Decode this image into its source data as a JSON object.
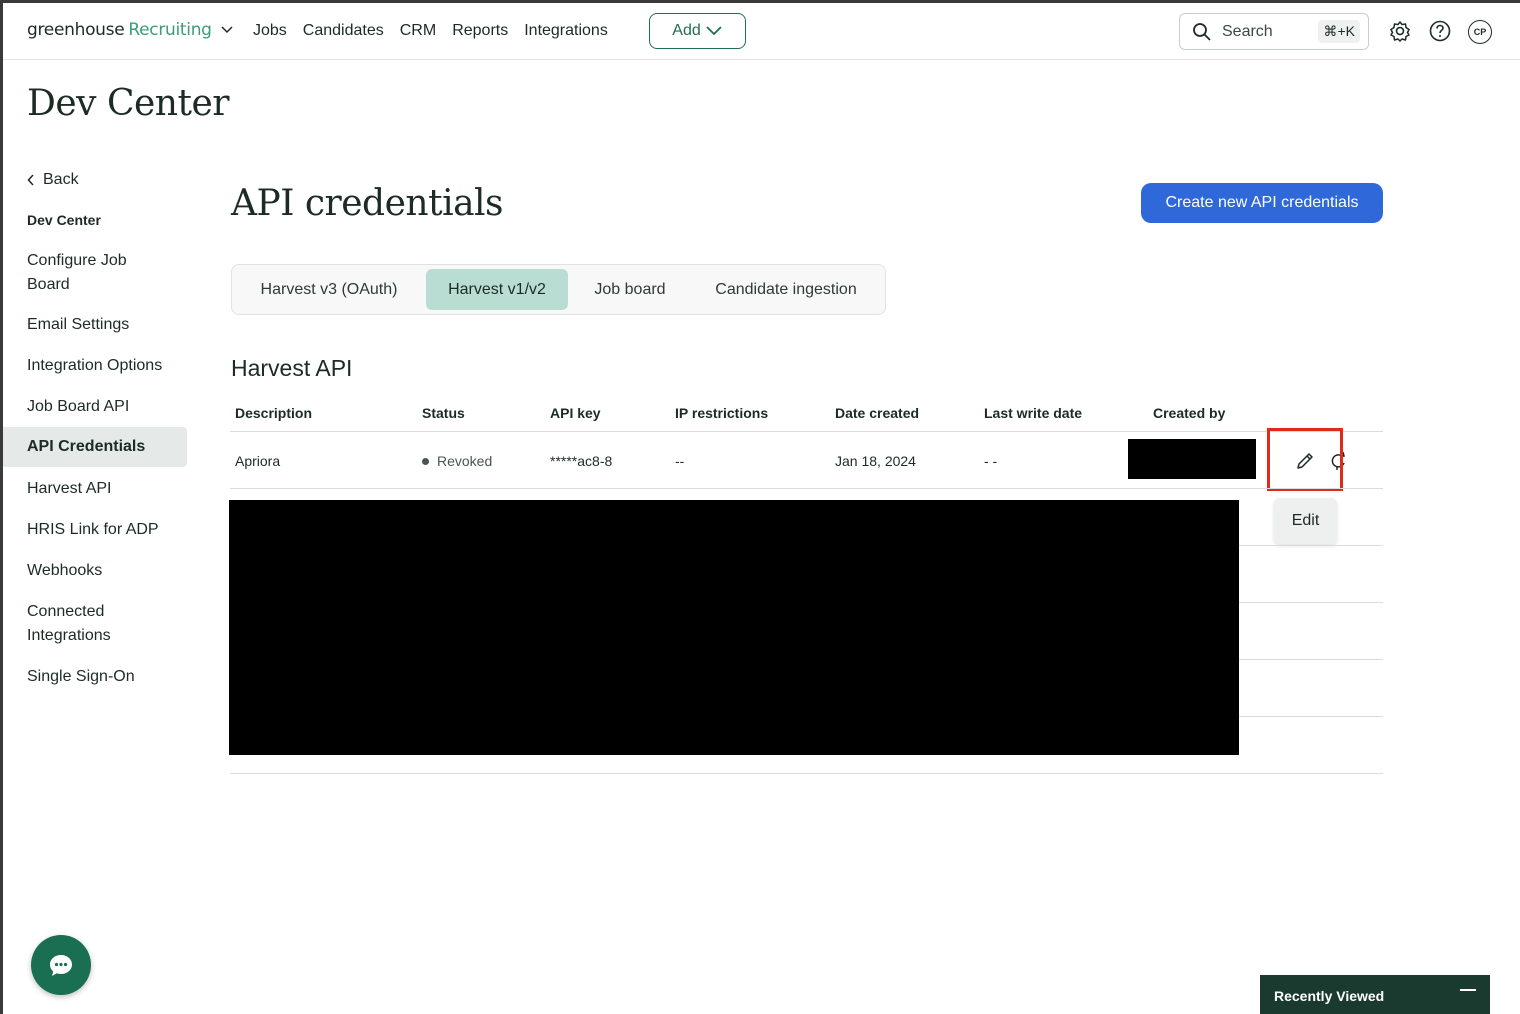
{
  "nav": {
    "logo_main": "greenhouse",
    "logo_product": "Recruiting",
    "links": [
      "Jobs",
      "Candidates",
      "CRM",
      "Reports",
      "Integrations"
    ],
    "add_label": "Add",
    "search_placeholder": "Search",
    "search_shortcut": "⌘+K",
    "avatar_initials": "CP"
  },
  "page_title": "Dev Center",
  "sidebar": {
    "back_label": "Back",
    "heading": "Dev Center",
    "items": [
      {
        "label": "Configure Job Board",
        "active": false
      },
      {
        "label": "Email Settings",
        "active": false
      },
      {
        "label": "Integration Options",
        "active": false
      },
      {
        "label": "Job Board API",
        "active": false
      },
      {
        "label": "API Credentials",
        "active": true
      },
      {
        "label": "Harvest API",
        "active": false
      },
      {
        "label": "HRIS Link for ADP",
        "active": false
      },
      {
        "label": "Webhooks",
        "active": false
      },
      {
        "label": "Connected Integrations",
        "active": false
      },
      {
        "label": "Single Sign-On",
        "active": false
      }
    ]
  },
  "main": {
    "heading": "API credentials",
    "create_button": "Create new API credentials",
    "tabs": [
      {
        "label": "Harvest v3 (OAuth)",
        "active": false
      },
      {
        "label": "Harvest v1/v2",
        "active": true
      },
      {
        "label": "Job board",
        "active": false
      },
      {
        "label": "Candidate ingestion",
        "active": false
      }
    ],
    "section_title": "Harvest API",
    "table": {
      "columns": [
        "Description",
        "Status",
        "API key",
        "IP restrictions",
        "Date created",
        "Last write date",
        "Created by"
      ],
      "rows": [
        {
          "description": "Apriora",
          "status": "Revoked",
          "api_key": "*****ac8-8",
          "ip_restrictions": "--",
          "date_created": "Jan 18, 2024",
          "last_write_date": "- -",
          "created_by": "[redacted]"
        }
      ]
    },
    "edit_tooltip": "Edit"
  },
  "footer": {
    "recently_viewed": "Recently Viewed"
  },
  "colors": {
    "accent_green": "#1f6e55",
    "primary_blue": "#2f68d9",
    "active_tab": "#b9ddd2",
    "highlight_red": "#e02b1b"
  }
}
